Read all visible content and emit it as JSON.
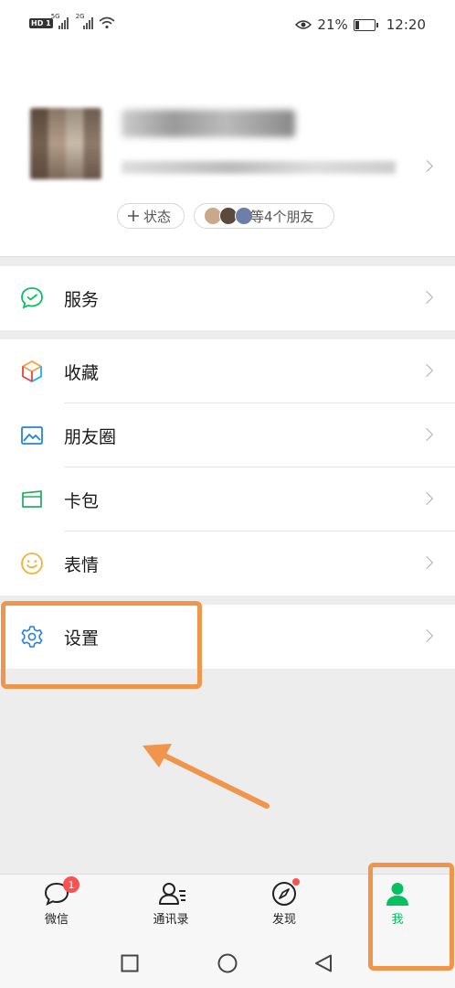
{
  "status_bar": {
    "network_tag_1": "5G",
    "network_tag_2": "2G",
    "battery": "21%",
    "battery_level": 0.21,
    "time": "12:20"
  },
  "profile": {
    "status_button": "状态",
    "friends_button": "等4个朋友"
  },
  "menu": {
    "services": "服务",
    "favorites": "收藏",
    "moments": "朋友圈",
    "cards": "卡包",
    "stickers": "表情",
    "settings": "设置"
  },
  "tabbar": {
    "chats": "微信",
    "chats_badge": "1",
    "contacts": "通讯录",
    "discover": "发现",
    "me": "我"
  },
  "colors": {
    "brand_green": "#07c160",
    "highlight_orange": "#f0954c",
    "badge_red": "#fa5151"
  }
}
